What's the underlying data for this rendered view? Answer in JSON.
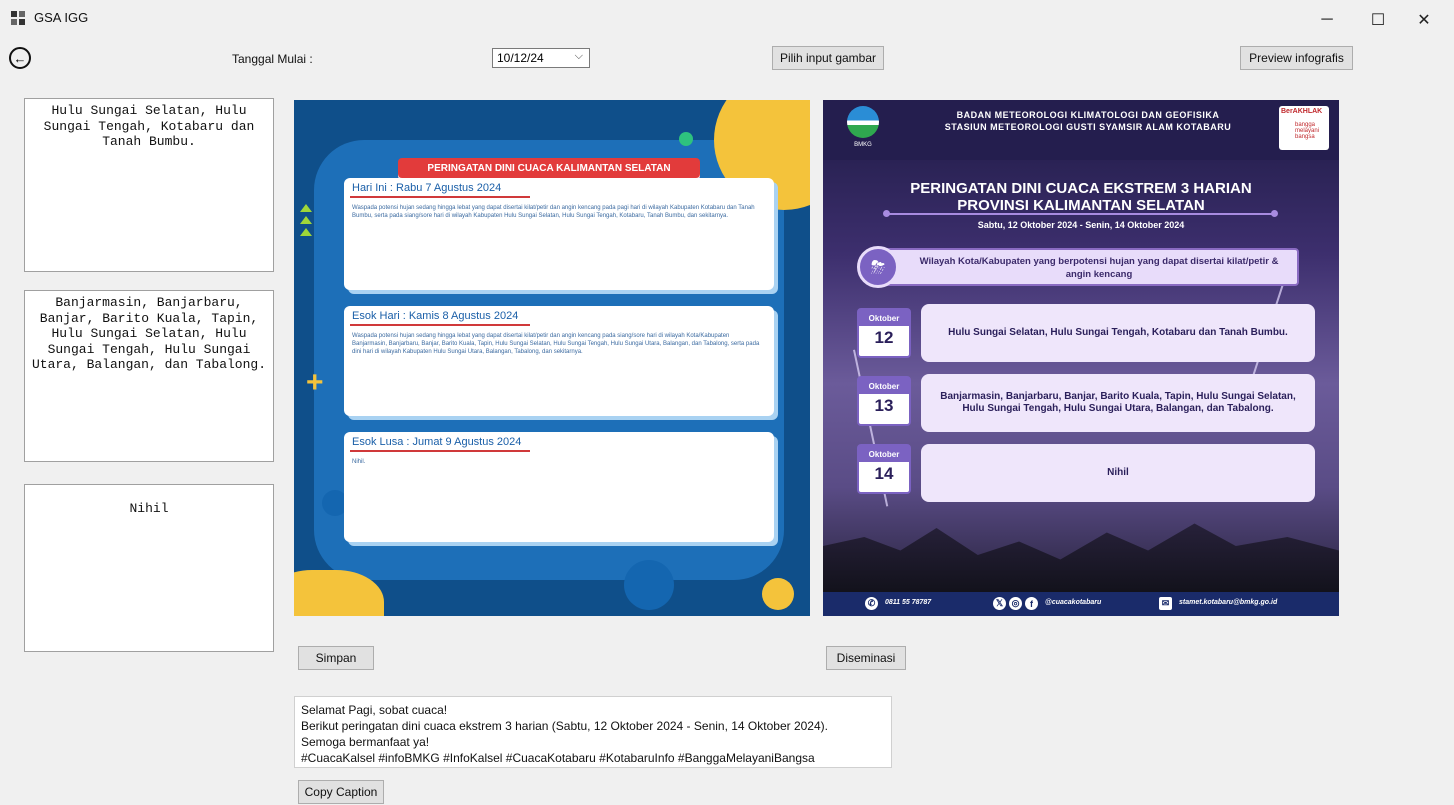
{
  "window": {
    "title": "GSA IGG",
    "minimize": "─",
    "maximize": "☐",
    "close": "✕"
  },
  "toolbar": {
    "start_date_label": "Tanggal Mulai :",
    "start_date_value": "10/12/24",
    "pick_image_label": "Pilih input gambar",
    "preview_label": "Preview infografis"
  },
  "regions": [
    "Hulu Sungai Selatan, Hulu Sungai Tengah, Kotabaru dan Tanah Bumbu.",
    "Banjarmasin, Banjarbaru, Banjar, Barito Kuala, Tapin, Hulu Sungai Selatan, Hulu Sungai Tengah, Hulu Sungai Utara, Balangan, dan Tabalong.",
    "Nihil"
  ],
  "template_preview": {
    "banner": "PERINGATAN DINI CUACA KALIMANTAN SELATAN",
    "cards": [
      {
        "title": "Hari Ini : Rabu 7 Agustus 2024",
        "body": "Waspada potensi hujan sedang hingga lebat yang dapat disertai kilat/petir dan angin kencang pada pagi hari di wilayah Kabupaten Kotabaru dan Tanah Bumbu, serta pada siang/sore hari di wilayah Kabupaten Hulu Sungai Selatan, Hulu Sungai Tengah, Kotabaru, Tanah Bumbu, dan sekitarnya."
      },
      {
        "title": "Esok Hari : Kamis 8 Agustus 2024",
        "body": "Waspada potensi hujan sedang hingga lebat yang dapat disertai kilat/petir dan angin kencang pada siang/sore hari di wilayah Kota/Kabupaten Banjarmasin, Banjarbaru, Banjar, Barito Kuala, Tapin, Hulu Sungai Selatan, Hulu Sungai Tengah, Hulu Sungai Utara, Balangan, dan Tabalong, serta pada dini hari di wilayah Kabupaten Hulu Sungai Utara, Balangan, Tabalong, dan sekitarnya."
      },
      {
        "title": "Esok Lusa : Jumat 9 Agustus 2024",
        "body": "Nihil."
      }
    ]
  },
  "infographic": {
    "header_line1": "BADAN METEOROLOGI KLIMATOLOGI DAN GEOFISIKA",
    "header_line2": "STASIUN METEOROLOGI GUSTI SYAMSIR ALAM KOTABARU",
    "logo_text": "BMKG",
    "badge_text": "BerAKHLAK",
    "badge_sub": "bangga melayani bangsa",
    "title_line1": "PERINGATAN DINI CUACA EKSTREM 3 HARIAN",
    "title_line2": "PROVINSI KALIMANTAN SELATAN",
    "date_range": "Sabtu, 12 Oktober 2024 - Senin, 14 Oktober 2024",
    "region_caption": "Wilayah Kota/Kabupaten yang berpotensi hujan yang dapat disertai kilat/petir & angin kencang",
    "days": [
      {
        "month": "Oktober",
        "day": "12",
        "text": "Hulu Sungai Selatan, Hulu Sungai Tengah, Kotabaru dan Tanah Bumbu."
      },
      {
        "month": "Oktober",
        "day": "13",
        "text": "Banjarmasin, Banjarbaru, Banjar, Barito Kuala, Tapin, Hulu Sungai Selatan, Hulu Sungai Tengah, Hulu Sungai Utara, Balangan, dan Tabalong."
      },
      {
        "month": "Oktober",
        "day": "14",
        "text": "Nihil"
      }
    ],
    "phone": "0811 55 78787",
    "social": "@cuacakotabaru",
    "email": "stamet.kotabaru@bmkg.go.id"
  },
  "actions": {
    "save_label": "Simpan",
    "disseminate_label": "Diseminasi",
    "copy_caption_label": "Copy Caption"
  },
  "caption": {
    "line1": "Selamat Pagi, sobat cuaca!",
    "line2": "Berikut peringatan dini cuaca ekstrem 3 harian (Sabtu, 12 Oktober 2024 - Senin, 14 Oktober 2024).",
    "line3": "Semoga bermanfaat ya!",
    "line4": "#CuacaKalsel #infoBMKG #InfoKalsel #CuacaKotabaru #KotabaruInfo #BanggaMelayaniBangsa"
  },
  "colors": {
    "window_bg": "#f0f0f0",
    "template_blue": "#0f4f8a",
    "accent_yellow": "#f4c33b",
    "banner_red": "#e23b3b",
    "infographic_purple": "#7b62c2"
  }
}
